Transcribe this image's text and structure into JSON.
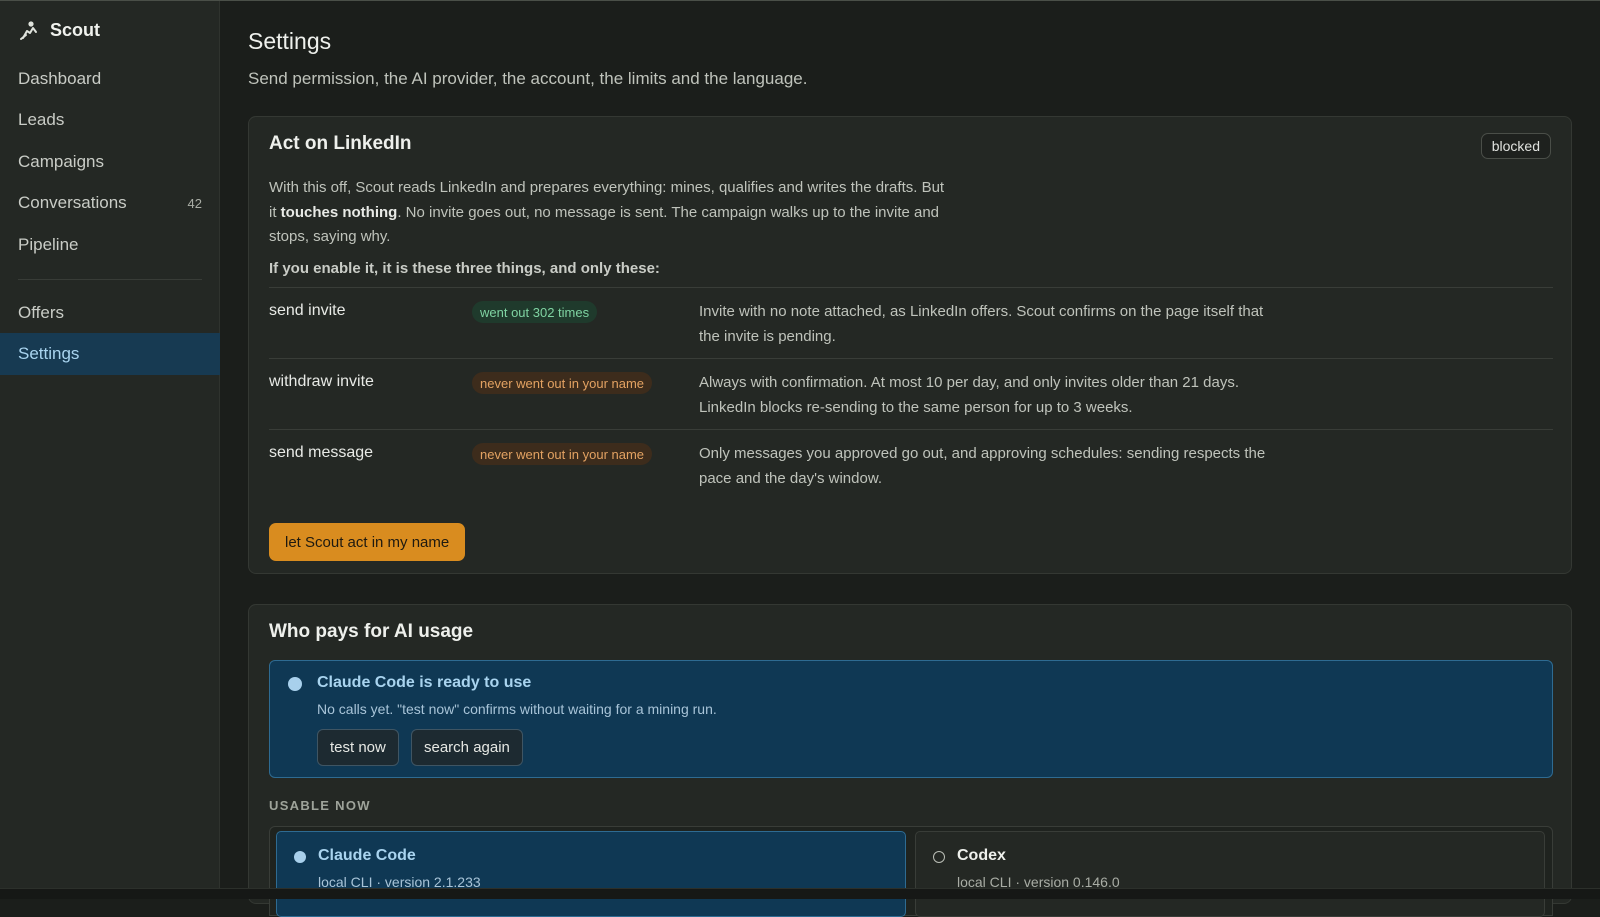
{
  "app": {
    "name": "Scout"
  },
  "sidebar": {
    "items": [
      {
        "label": "Dashboard"
      },
      {
        "label": "Leads"
      },
      {
        "label": "Campaigns"
      },
      {
        "label": "Conversations",
        "count": "42"
      },
      {
        "label": "Pipeline"
      },
      {
        "label": "Offers"
      },
      {
        "label": "Settings",
        "active": true
      }
    ]
  },
  "page": {
    "title": "Settings",
    "subtitle": "Send permission, the AI provider, the account, the limits and the language."
  },
  "linkedin_card": {
    "title": "Act on LinkedIn",
    "status_badge": "blocked",
    "desc_part1": "With this off, Scout reads LinkedIn and prepares everything: mines, qualifies and writes the drafts. But it ",
    "desc_bold": "touches nothing",
    "desc_part2": ". No invite goes out, no message is sent. The campaign walks up to the invite and stops, saying why.",
    "lead": "If you enable it, it is these three things, and only these:",
    "permissions": [
      {
        "name": "send invite",
        "pill": "went out 302 times",
        "pill_color": "#7fd3a2",
        "desc": "Invite with no note attached, as LinkedIn offers. Scout confirms on the page itself that the invite is pending."
      },
      {
        "name": "withdraw invite",
        "pill": "never went out in your name",
        "pill_color": "#e3a262",
        "desc": "Always with confirmation. At most 10 per day, and only invites older than 21 days. LinkedIn blocks re-sending to the same person for up to 3 weeks."
      },
      {
        "name": "send message",
        "pill": "never went out in your name",
        "pill_color": "#e3a262",
        "desc": "Only messages you approved go out, and approving schedules: sending respects the pace and the day's window."
      }
    ],
    "enable_button": "let Scout act in my name",
    "accent_color": "#d98c1f"
  },
  "ai_card": {
    "title": "Who pays for AI usage",
    "status": {
      "title": "Claude Code is ready to use",
      "subtitle": "No calls yet. \"test now\" confirms without waiting for a mining run.",
      "buttons": [
        "test now",
        "search again"
      ]
    },
    "usable_label": "USABLE NOW",
    "options": [
      {
        "name": "Claude Code",
        "detail": "local CLI · version 2.1.233",
        "selected": true
      },
      {
        "name": "Codex",
        "detail": "local CLI · version 0.146.0",
        "selected": false
      }
    ]
  }
}
